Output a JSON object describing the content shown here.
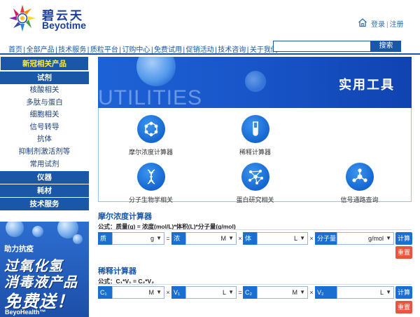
{
  "header": {
    "brand_cn": "碧云天",
    "brand_en": "Beyotime",
    "login": "登录",
    "separator": "|",
    "register": "注册"
  },
  "topnav": {
    "items": [
      "首页",
      "全部产品",
      "技术服务",
      "质粒平台",
      "订购中心",
      "免费试用",
      "促销活动",
      "技术咨询",
      "关于我们"
    ],
    "separator": "|"
  },
  "search": {
    "placeholder": "",
    "button": "搜索"
  },
  "sidebar": {
    "featured": "新冠相关产品",
    "reagent_head": "试剂",
    "reagent_items": [
      "核酸相关",
      "多肽与蛋白",
      "细胞相关",
      "信号转导",
      "抗体",
      "抑制剂激活剂等",
      "常用试剂"
    ],
    "instrument": "仪器",
    "consumables": "耗材",
    "tech_service": "技术服务"
  },
  "promo": {
    "line1": "助力抗疫",
    "line2": "过氧化氢",
    "line3": "消毒液产品",
    "line4": "免费送！",
    "line5": "BeyoHealth™"
  },
  "banner": {
    "watermark": "UTILITIES",
    "title": "实用工具"
  },
  "tools": [
    {
      "label": "摩尔浓度计算器",
      "icon": "molecule-ring-icon"
    },
    {
      "label": "稀释计算器",
      "icon": "test-tube-icon"
    },
    {
      "label": "分子生物学相关",
      "icon": "dna-icon"
    },
    {
      "label": "蛋白研究相关",
      "icon": "protein-network-icon"
    },
    {
      "label": "信号通路查询",
      "icon": "signal-node-icon"
    }
  ],
  "molarity": {
    "title": "摩尔浓度计算器",
    "formula": "公式：质量(g) = 浓度(mol/L)*体积(L)*分子量(g/mol)",
    "f1": {
      "label": "质量",
      "unit": "g"
    },
    "op1": "=",
    "f2": {
      "label": "浓度",
      "unit": "M"
    },
    "op2": "×",
    "f3": {
      "label": "体积",
      "unit": "L"
    },
    "op3": "×",
    "f4": {
      "label": "分子量",
      "unit": "g/mol"
    },
    "calc": "计算",
    "reset": "重置"
  },
  "dilution": {
    "title": "稀释计算器",
    "formula": "公式：C₁*V₁ = C₂*V₂",
    "f1": {
      "label": "C₁",
      "unit": "M"
    },
    "op1": "×",
    "f2": {
      "label": "V₁",
      "unit": "L"
    },
    "op2": "=",
    "f3": {
      "label": "C₂",
      "unit": "M"
    },
    "op3": "×",
    "f4": {
      "label": "V₂",
      "unit": "L"
    },
    "calc": "计算",
    "reset": "重置"
  },
  "colors": {
    "primary": "#1a57a6",
    "accent": "#1a6fd0",
    "featured_text": "#ffec4d",
    "reset": "#e8553f"
  }
}
